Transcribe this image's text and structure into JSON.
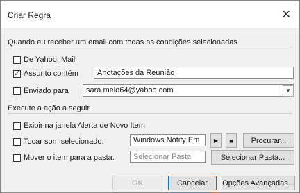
{
  "dialog": {
    "title": "Criar Regra"
  },
  "conditions": {
    "header": "Quando eu receber um email com todas as condições selecionadas",
    "from_label": "De Yahoo! Mail",
    "subject_label": "Assunto contém",
    "subject_value": "Anotações da Reunião",
    "sent_to_label": "Enviado para",
    "sent_to_value": "sara.melo64@yahoo.com"
  },
  "actions": {
    "header": "Execute a ação a seguir",
    "alert_label": "Exibir na janela Alerta de Novo Item",
    "sound_label": "Tocar som selecionado:",
    "sound_value": "Windows Notify Em",
    "play_glyph": "▶",
    "stop_glyph": "■",
    "browse_label": "Procurar...",
    "move_label": "Mover o item para a pasta:",
    "folder_placeholder": "Selecionar Pasta",
    "select_folder_label": "Selecionar Pasta..."
  },
  "footer": {
    "ok_label": "OK",
    "cancel_label": "Cancelar",
    "advanced_label": "Opções Avançadas..."
  },
  "checkboxes": {
    "from": false,
    "subject": true,
    "sent_to": false,
    "alert": false,
    "sound": false,
    "move": false
  }
}
